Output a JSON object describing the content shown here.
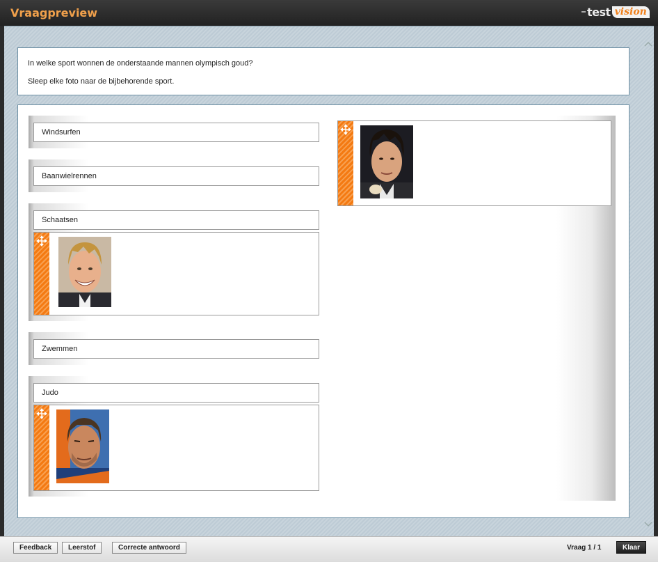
{
  "app": {
    "title": "Vraagpreview",
    "logo_test": "test",
    "logo_vision": "vision"
  },
  "question": {
    "line1": "In welke sport wonnen de onderstaande mannen olympisch goud?",
    "line2": "Sleep elke foto naar de bijbehorende sport."
  },
  "targets": [
    {
      "label": "Windsurfen"
    },
    {
      "label": "Baanwielrennen"
    },
    {
      "label": "Schaatsen"
    },
    {
      "label": "Zwemmen"
    },
    {
      "label": "Judo"
    }
  ],
  "footer": {
    "feedback": "Feedback",
    "study": "Leerstof",
    "correct": "Correcte antwoord",
    "page": "Vraag 1 / 1",
    "done": "Klaar"
  },
  "colors": {
    "accent_orange": "#f47a12",
    "title_orange": "#f0a04b",
    "border_blue": "#6b8ea3"
  },
  "icons": [
    "move-icon",
    "scroll-up-icon",
    "scroll-down-icon"
  ]
}
